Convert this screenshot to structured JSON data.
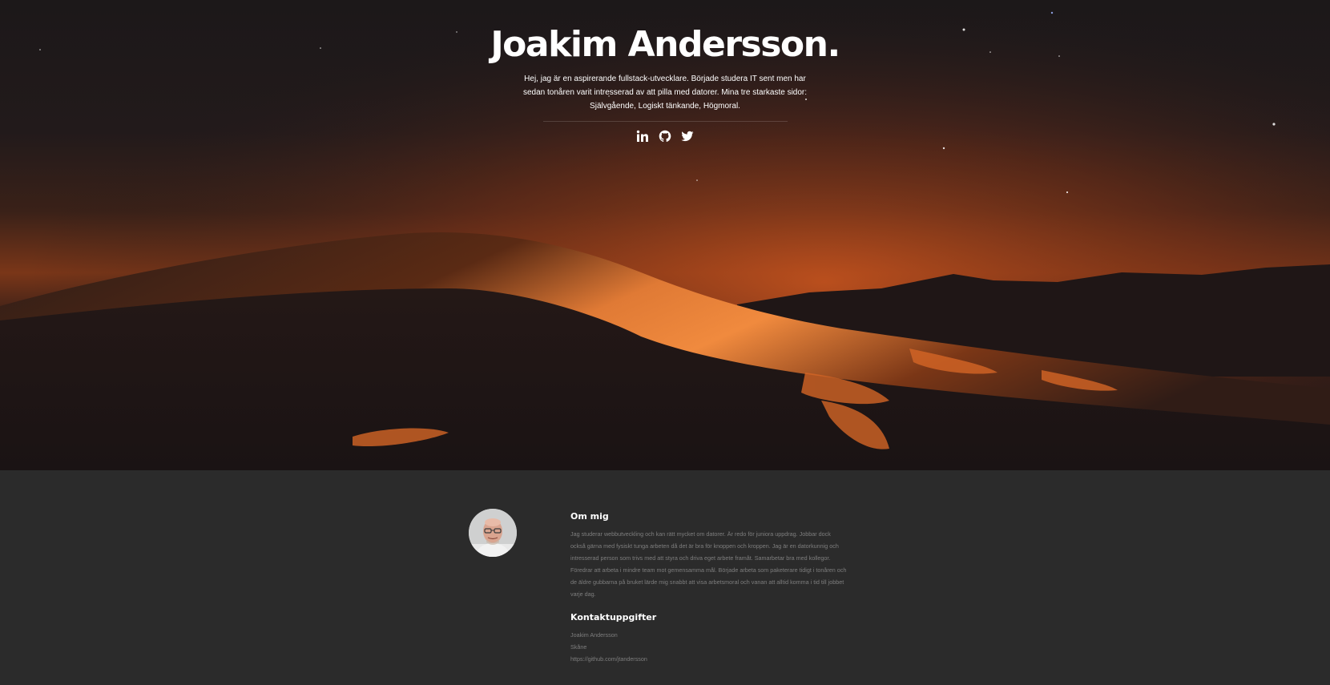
{
  "hero": {
    "title": "Joakim Andersson.",
    "intro": "Hej, jag är en aspirerande fullstack-utvecklare. Började studera IT sent men har sedan tonåren varit intresserad av att pilla med datorer. Mina tre starkaste sidor: Självgående, Logiskt tänkande, Högmoral.",
    "social_icons": [
      "linkedin-icon",
      "github-icon",
      "twitter-icon"
    ]
  },
  "about": {
    "heading": "Om mig",
    "body": "Jag studerar webbutveckling och kan rätt mycket om datorer. Är redo för juniora uppdrag. Jobbar dock också gärna med fysiskt tunga arbeten då det är bra för knoppen och kroppen. Jag är en datorkunnig och intresserad person som trivs med att styra och driva eget arbete framåt. Samarbetar bra med kollegor. Föredrar att arbeta i mindre team mot gemensamma mål. Började arbeta som paketerare tidigt i tonåren och de äldre gubbarna på bruket lärde mig snabbt att visa arbetsmoral och vanan att alltid komma i tid till jobbet varje dag."
  },
  "contact": {
    "heading": "Kontaktuppgifter",
    "name": "Joakim Andersson",
    "location": "Skåne",
    "github": "https://github.com/jtandersson"
  },
  "colors": {
    "page_bg": "#2b2b2b",
    "heading": "#ffffff",
    "body_text": "#7e7e7e",
    "dune_orange": "#e0702a"
  }
}
